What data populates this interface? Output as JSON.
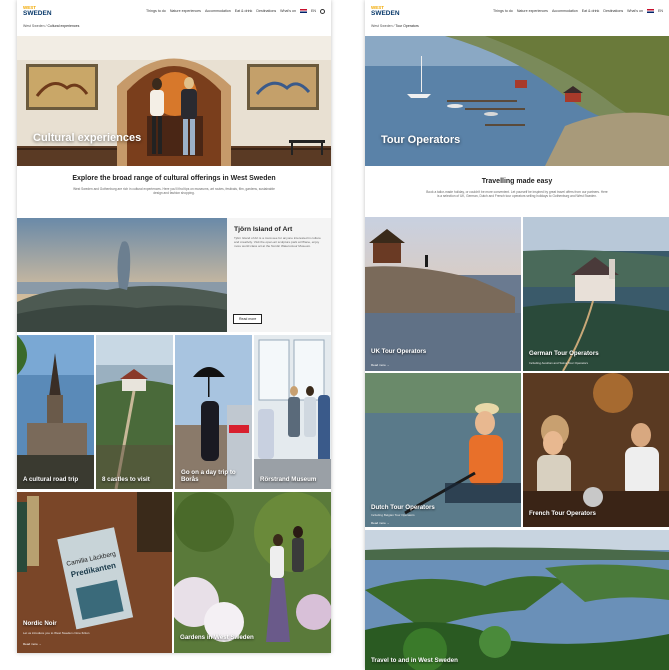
{
  "left": {
    "logo": {
      "top": "WEST",
      "bottom": "SWEDEN"
    },
    "nav": [
      "Things to do",
      "Nature experiences",
      "Accommodation",
      "Eat & drink",
      "Destinations",
      "What's on",
      "EN"
    ],
    "breadcrumb": {
      "home": "West Sweden",
      "current": "Cultural experiences"
    },
    "hero_title": "Cultural experiences",
    "intro": {
      "title": "Explore the broad range of cultural offerings in West Sweden",
      "text": "West Sweden and Gothenburg are rich in cultural experiences. Here you'll find tips on museums, art routes, festivals, film, gardens, sustainable design and fashion shopping."
    },
    "feature": {
      "title": "Tjörn Island of Art",
      "text": "Tjörn Island of Art is a must-see for anyone interested in culture and creativity. Visit the open-air sculpture park at Pilane, enjoy more world class art at the Nordic Watercolour Museum.",
      "button": "Read more"
    },
    "cards": [
      {
        "title": "A cultural road trip"
      },
      {
        "title": "8 castles to visit"
      },
      {
        "title": "Go on a day trip to Borås"
      },
      {
        "title": "Rörstrand Museum"
      }
    ],
    "nordic": {
      "title": "Nordic Noir",
      "text": "Let us introduce you to West Sweden crime fiction",
      "more": "Read more",
      "book_author": "Camilla Läckberg",
      "book_title": "Predikanten"
    },
    "gardens": {
      "title": "Gardens in West Sweden"
    }
  },
  "right": {
    "logo": {
      "top": "WEST",
      "bottom": "SWEDEN"
    },
    "nav": [
      "Things to do",
      "Nature experiences",
      "Accommodation",
      "Eat & drink",
      "Destinations",
      "What's on",
      "EN"
    ],
    "breadcrumb": {
      "home": "West Sweden",
      "current": "Tour Operators"
    },
    "hero_title": "Tour Operators",
    "intro": {
      "title": "Travelling made easy",
      "text": "Book a tailor-made holiday, or couldn't be more convenient. Let yourself be inspired by great travel offers from our partners. Here is a selection of UK, German, Dutch and French tour operators selling holidays to Gothenburg and West Sweden."
    },
    "cards": [
      {
        "title": "UK Tour Operators",
        "more": "Read more"
      },
      {
        "title": "German Tour Operators",
        "sub": "Including Austrian and Swiss Tour Operators"
      },
      {
        "title": "Dutch Tour Operators",
        "sub": "Including Belgian Tour Operators",
        "more": "Read more"
      },
      {
        "title": "French Tour Operators"
      }
    ],
    "bottom_title": "Travel to and in West Sweden"
  }
}
